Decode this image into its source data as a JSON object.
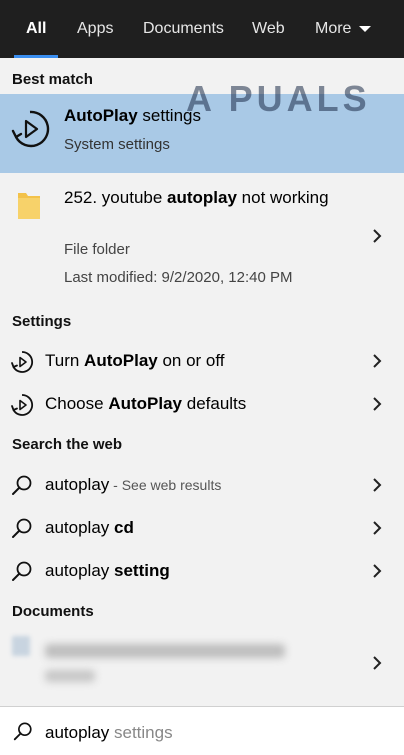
{
  "tabs": [
    {
      "label": "All"
    },
    {
      "label": "Apps"
    },
    {
      "label": "Documents"
    },
    {
      "label": "Web"
    },
    {
      "label": "More"
    }
  ],
  "watermark": "A PUALS",
  "sections": {
    "best_match": "Best match",
    "settings": "Settings",
    "search_web": "Search the web",
    "documents": "Documents"
  },
  "best_match": {
    "title_bold": "AutoPlay",
    "title_rest": " settings",
    "subtitle": "System settings"
  },
  "folder": {
    "name_pre": "252. youtube ",
    "name_bold": "autoplay",
    "name_post": " not working",
    "type": "File folder",
    "modified": "Last modified: 9/2/2020, 12:40 PM"
  },
  "settings_items": [
    {
      "pre": "Turn ",
      "bold": "AutoPlay",
      "post": " on or off"
    },
    {
      "pre": "Choose ",
      "bold": "AutoPlay",
      "post": " defaults"
    }
  ],
  "web_items": [
    {
      "text": "autoplay",
      "bold": "",
      "hint": " - See web results"
    },
    {
      "text": "autoplay ",
      "bold": "cd",
      "hint": ""
    },
    {
      "text": "autoplay ",
      "bold": "setting",
      "hint": ""
    }
  ],
  "search": {
    "typed": "autoplay",
    "suggestion": " settings"
  },
  "colors": {
    "tabbar": "#1f1f1f",
    "tab_underline": "#3a8ef0",
    "best_match_bg": "#a9c9e6",
    "panel_bg": "#f2f2f2"
  }
}
